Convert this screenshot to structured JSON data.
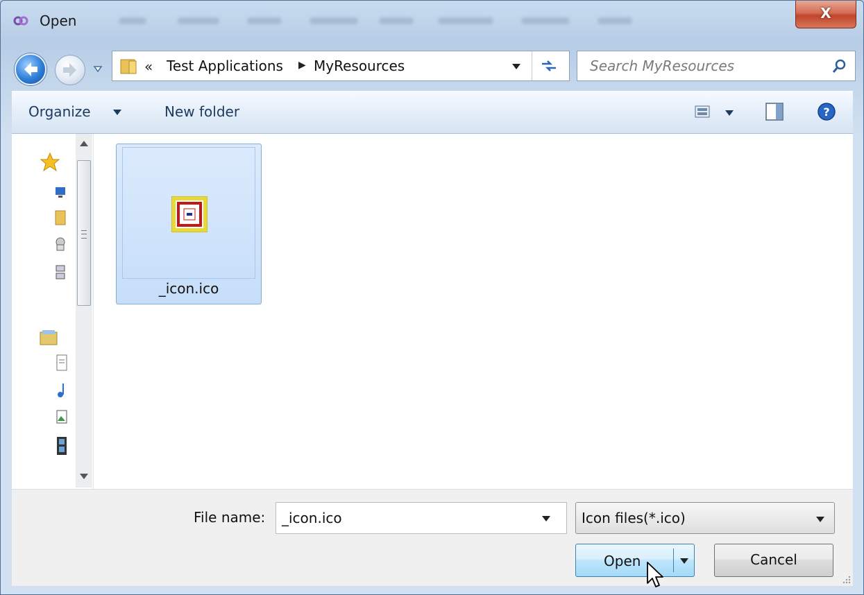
{
  "window": {
    "title": "Open",
    "close_label": "X"
  },
  "address": {
    "overflow_chevron": "«",
    "crumbs": [
      "Test Applications",
      "MyResources"
    ]
  },
  "search": {
    "placeholder": "Search MyResources"
  },
  "toolbar": {
    "organize_label": "Organize",
    "new_folder_label": "New folder"
  },
  "nav_pane": {
    "icons": [
      "favorites-star-icon",
      "desktop-icon",
      "downloads-folder-icon",
      "recent-places-icon",
      "network-icon",
      "libraries-icon",
      "documents-icon",
      "music-icon",
      "pictures-icon",
      "videos-icon"
    ]
  },
  "files": [
    {
      "name": "_icon.ico",
      "selected": true,
      "icon": "ico-file-thumbnail"
    }
  ],
  "footer": {
    "filename_label": "File name:",
    "filename_value": "_icon.ico",
    "filetype_value": "Icon files(*.ico)",
    "open_label": "Open",
    "cancel_label": "Cancel"
  },
  "colors": {
    "selection_bg": "#c6defa",
    "selection_border": "#84acdd",
    "close_red": "#c0452b",
    "accent_blue": "#2e7ed8"
  }
}
